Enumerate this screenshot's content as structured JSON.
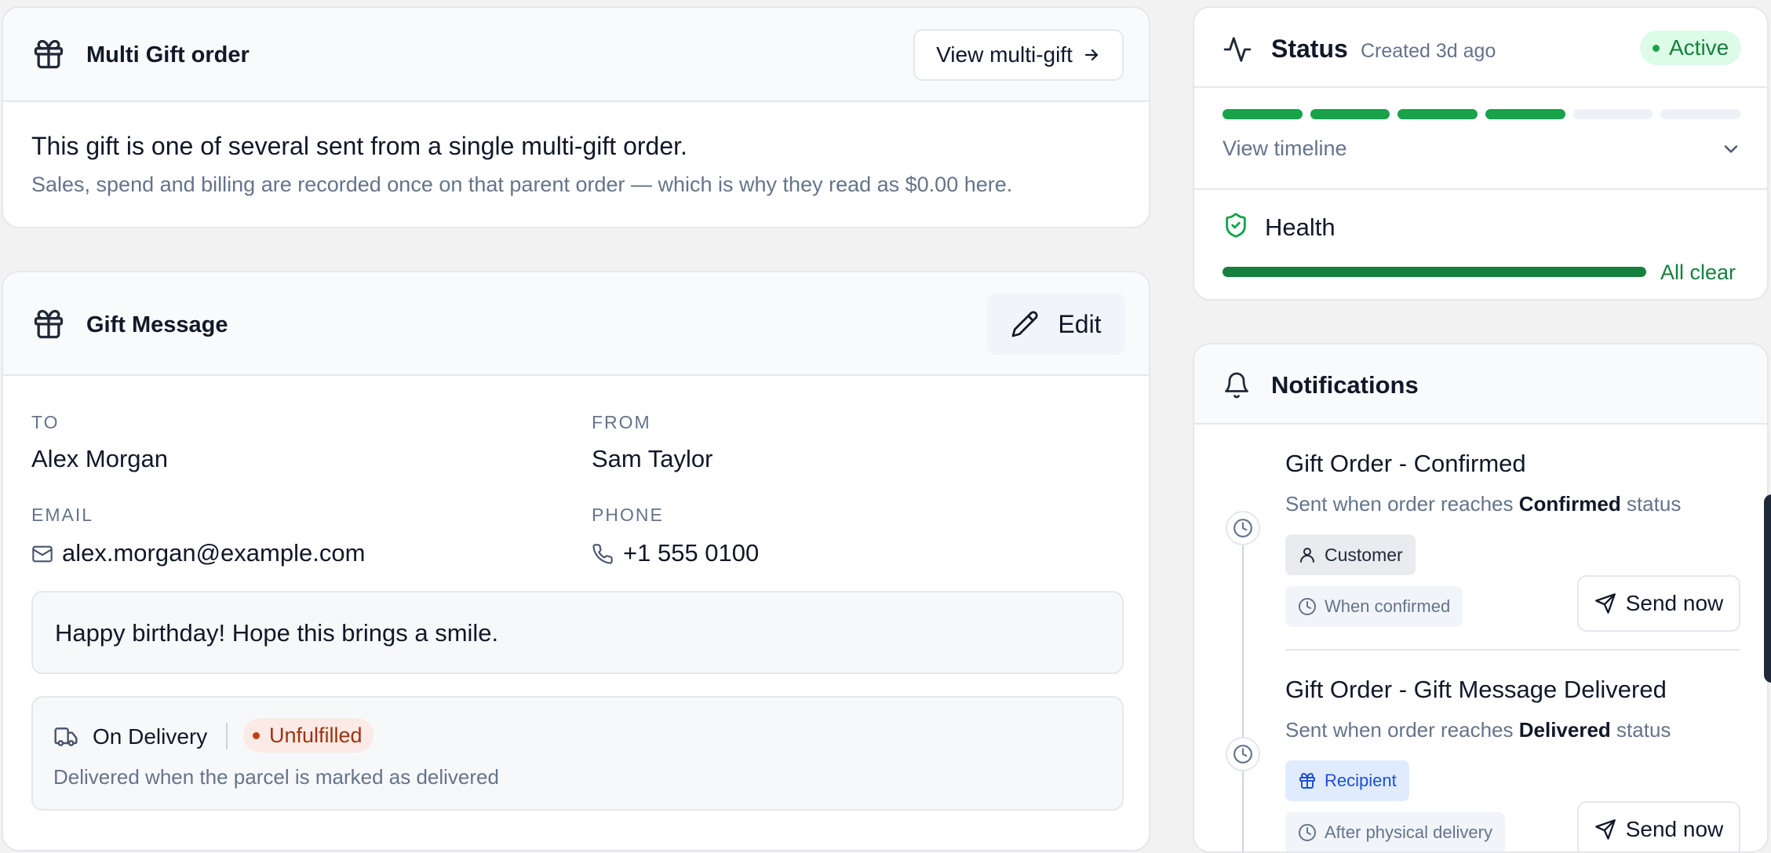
{
  "multi_gift": {
    "title": "Multi Gift order",
    "view_button": "View multi-gift",
    "headline": "This gift is one of several sent from a single multi-gift order.",
    "subtext": "Sales, spend and billing are recorded once on that parent order — which is why they read as $0.00 here."
  },
  "gift_message": {
    "title": "Gift Message",
    "edit_button": "Edit",
    "to_label": "TO",
    "to_value": "Alex Morgan",
    "from_label": "FROM",
    "from_value": "Sam Taylor",
    "email_label": "EMAIL",
    "email_value": "alex.morgan@example.com",
    "phone_label": "PHONE",
    "phone_value": "+1 555 0100",
    "message": "Happy birthday! Hope this brings a smile.",
    "delivery_label": "On Delivery",
    "delivery_status": "Unfulfilled",
    "delivery_note": "Delivered when the parcel is marked as delivered"
  },
  "status": {
    "title": "Status",
    "created": "Created 3d ago",
    "badge": "Active",
    "progress_filled": 4,
    "progress_total": 6,
    "timeline_link": "View timeline",
    "health_title": "Health",
    "health_fraction": 1.0,
    "health_text": "All clear"
  },
  "notifications": {
    "title": "Notifications",
    "items": [
      {
        "title": "Gift Order - Confirmed",
        "desc_prefix": "Sent when order reaches ",
        "desc_strong": "Confirmed",
        "desc_suffix": " status",
        "audience": "Customer",
        "trigger": "When confirmed",
        "send_label": "Send now"
      },
      {
        "title": "Gift Order - Gift Message Delivered",
        "desc_prefix": "Sent when order reaches ",
        "desc_strong": "Delivered",
        "desc_suffix": " status",
        "audience": "Recipient",
        "trigger": "After physical delivery",
        "send_label": "Send now"
      }
    ]
  },
  "colors": {
    "green": "#16a34a",
    "green_bg": "#dcfce7",
    "unfulfilled": "#9a3412",
    "unfulfilled_bg": "#fbeae5",
    "recipient": "#1d4ed8",
    "recipient_bg": "#e0ecfe",
    "track": "#eef2f6"
  }
}
